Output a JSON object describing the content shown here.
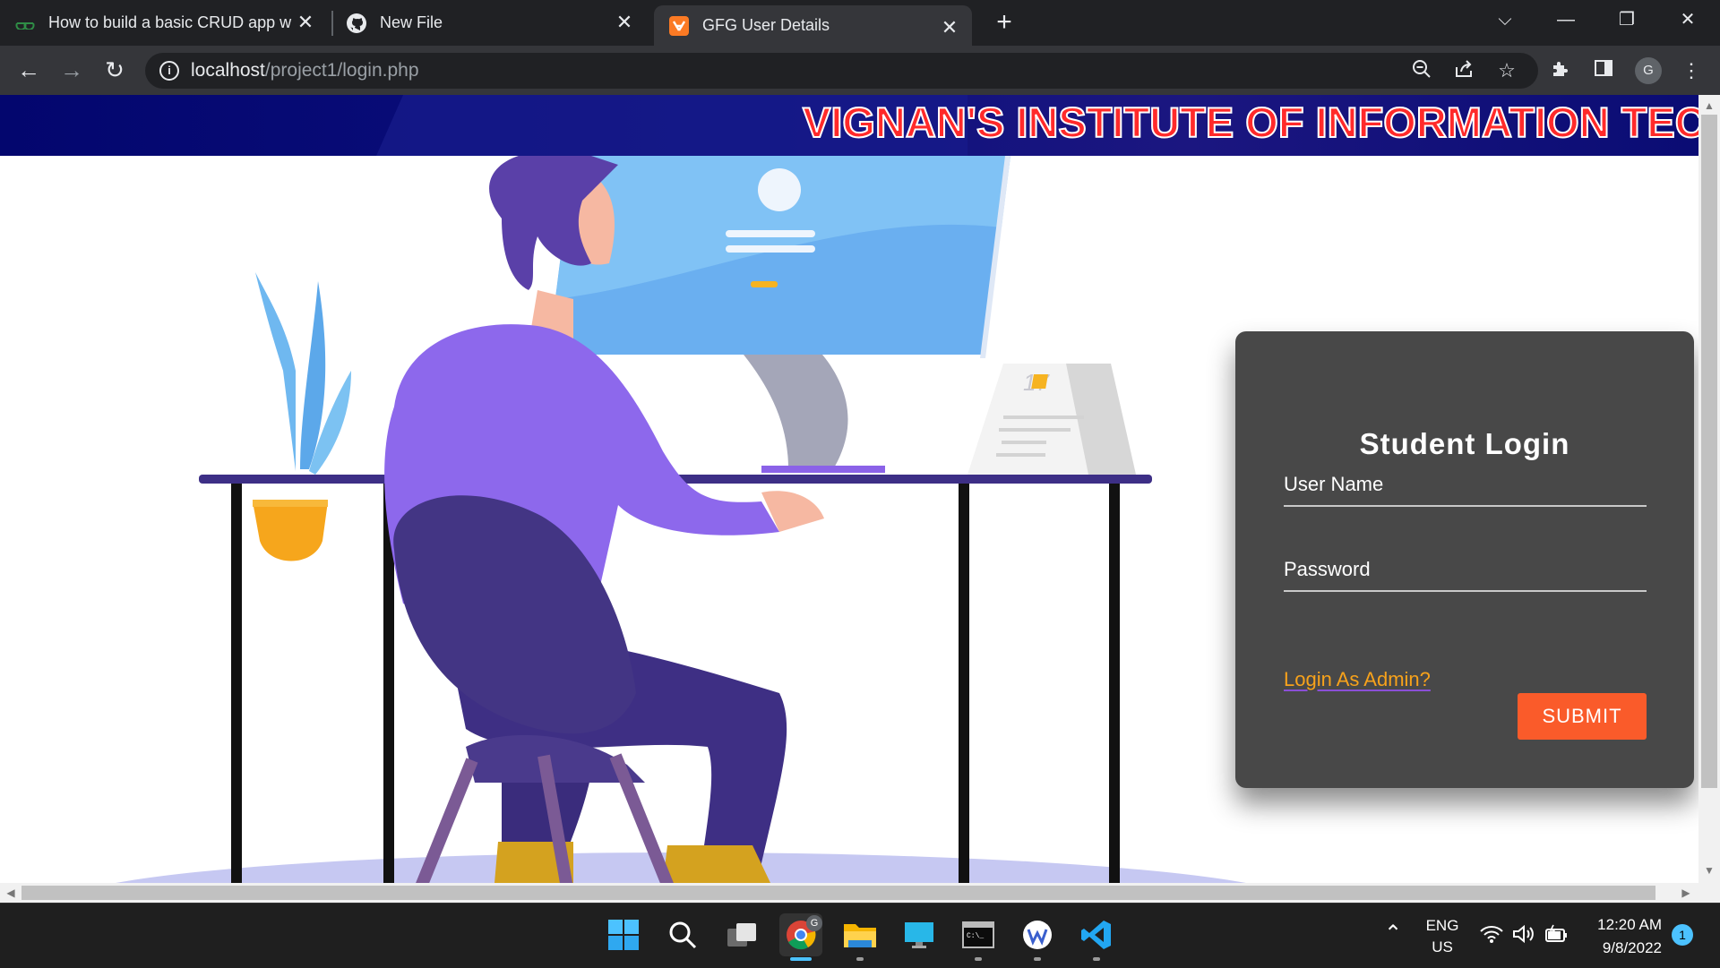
{
  "browser": {
    "tabs": [
      {
        "title": "How to build a basic CRUD app w",
        "favicon": "geeksforgeeks-icon"
      },
      {
        "title": "New File",
        "favicon": "github-icon"
      },
      {
        "title": "GFG User Details",
        "favicon": "xampp-icon",
        "active": true
      }
    ],
    "url_host": "localhost",
    "url_path": "/project1/login.php",
    "profile_initial": "G"
  },
  "page": {
    "banner_text": "VIGNAN'S INSTITUTE OF INFORMATION TEC",
    "login": {
      "title": "Student Login",
      "username_label": "User Name",
      "password_label": "Password",
      "admin_link": "Login As Admin?",
      "submit_label": "SUBMIT"
    }
  },
  "taskbar": {
    "language_line1": "ENG",
    "language_line2": "US",
    "time": "12:20 AM",
    "date": "9/8/2022",
    "notification_count": "1"
  },
  "colors": {
    "banner_bg": "#03066e",
    "banner_text": "#ff2a2a",
    "card_bg": "#484848",
    "submit_bg": "#fa5b2a",
    "admin_link": "#f7a21b"
  }
}
